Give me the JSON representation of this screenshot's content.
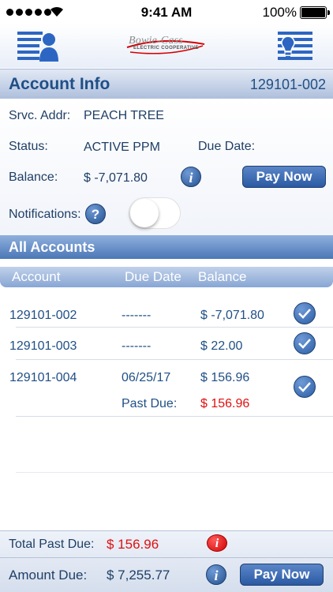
{
  "status_bar": {
    "time": "9:41 AM",
    "battery": "100%"
  },
  "header": {
    "logo_name": "Bowie-Cass",
    "logo_tagline": "ELECTRIC COOPERATIVE"
  },
  "account_info": {
    "title": "Account Info",
    "account_number": "129101-002",
    "service_address_label": "Srvc. Addr:",
    "service_address": "PEACH TREE",
    "status_label": "Status:",
    "status": "ACTIVE PPM",
    "due_date_label": "Due Date:",
    "balance_label": "Balance:",
    "balance": "$ -7,071.80",
    "pay_now_label": "Pay Now",
    "notifications_label": "Notifications:",
    "notifications_enabled": false
  },
  "all_accounts": {
    "title": "All Accounts",
    "columns": [
      "Account",
      "Due Date",
      "Balance"
    ],
    "rows": [
      {
        "account": "129101-002",
        "due_date": "-------",
        "balance": "$ -7,071.80",
        "selected": true
      },
      {
        "account": "129101-003",
        "due_date": "-------",
        "balance": "$ 22.00",
        "selected": true
      },
      {
        "account": "129101-004",
        "due_date": "06/25/17",
        "balance": "$ 156.96",
        "past_due_label": "Past Due:",
        "past_due": "$ 156.96",
        "selected": true
      }
    ]
  },
  "footer": {
    "total_past_due_label": "Total Past Due:",
    "total_past_due": "$ 156.96",
    "amount_due_label": "Amount Due:",
    "amount_due": "$ 7,255.77",
    "pay_now_label": "Pay Now"
  },
  "colors": {
    "brand_blue": "#1f4f86",
    "alert_red": "#e01010"
  },
  "icons": [
    "menu-icon",
    "bowie-cass-logo",
    "outage-report-icon",
    "info-icon",
    "help-icon",
    "check-icon"
  ]
}
